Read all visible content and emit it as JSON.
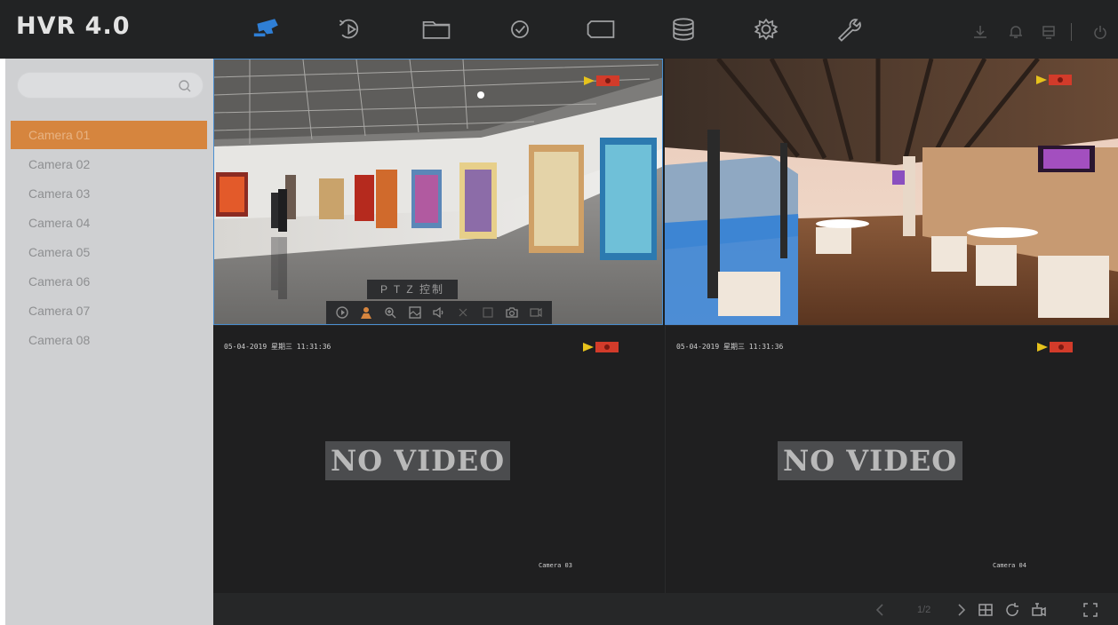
{
  "app": {
    "title": "HVR 4.0"
  },
  "top_nav": [
    {
      "icon": "live-view-camera-icon",
      "active": true
    },
    {
      "icon": "playback-icon"
    },
    {
      "icon": "file-folder-icon"
    },
    {
      "icon": "smart-search-icon"
    },
    {
      "icon": "display-monitor-icon"
    },
    {
      "icon": "storage-database-icon"
    },
    {
      "icon": "settings-gear-icon"
    },
    {
      "icon": "maintenance-wrench-icon"
    }
  ],
  "top_right": [
    "download-icon",
    "alarm-bell-icon",
    "screen-icon",
    "power-icon"
  ],
  "sidebar": {
    "search_placeholder": "",
    "cameras": [
      "Camera 01",
      "Camera 02",
      "Camera 03",
      "Camera 04",
      "Camera 05",
      "Camera 06",
      "Camera 07",
      "Camera 08"
    ],
    "selected": "Camera 01"
  },
  "tiles": [
    {
      "camera": "Camera 01",
      "scene": "art gallery"
    },
    {
      "camera": "Camera 02",
      "scene": "restaurant"
    },
    {
      "timestamp": "05-04-2019 星期三 11:31:36",
      "no_video": "NO VIDEO",
      "label": "Camera 03"
    },
    {
      "timestamp": "05-04-2019 星期三 11:31:36",
      "no_video": "NO VIDEO",
      "label": "Camera 04"
    }
  ],
  "ptz": {
    "tooltip": "P T Z 控制"
  },
  "bottom": {
    "page": "1/2"
  },
  "colors": {
    "accent": "#d6853e",
    "nav_active": "#2f7fd6",
    "topbar": "#222324",
    "sidebar": "#cfd0d2"
  }
}
